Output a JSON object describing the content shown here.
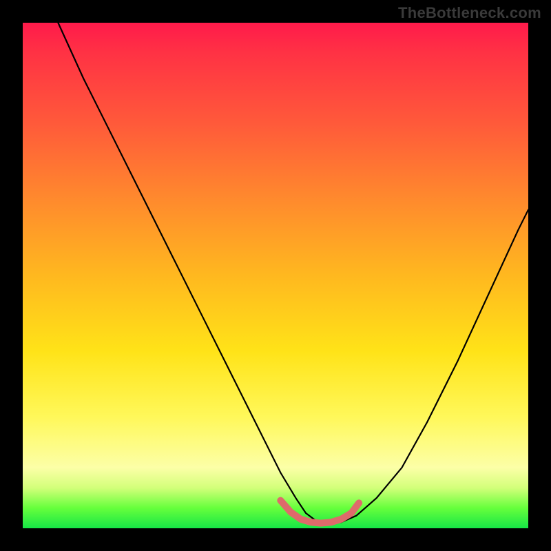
{
  "watermark": "TheBottleneck.com",
  "chart_data": {
    "type": "line",
    "title": "",
    "xlabel": "",
    "ylabel": "",
    "xlim": [
      0,
      100
    ],
    "ylim": [
      0,
      100
    ],
    "grid": false,
    "legend": false,
    "series": [
      {
        "name": "black-curve",
        "color": "#000000",
        "x": [
          7,
          12,
          18,
          24,
          30,
          36,
          42,
          47,
          51,
          54,
          56,
          58,
          60,
          63,
          66,
          70,
          75,
          80,
          86,
          92,
          98,
          100
        ],
        "y": [
          100,
          89,
          77,
          65,
          53,
          41,
          29,
          19,
          11,
          6,
          3,
          1.5,
          1,
          1.2,
          2.5,
          6,
          12,
          21,
          33,
          46,
          59,
          63
        ]
      },
      {
        "name": "pink-highlight",
        "color": "#de6b6b",
        "x": [
          51,
          53,
          55,
          57,
          59,
          61,
          63,
          65,
          66.5
        ],
        "y": [
          5.5,
          3.2,
          1.8,
          1.2,
          1.0,
          1.2,
          1.8,
          3.0,
          5.0
        ]
      }
    ],
    "background_gradient_stops": [
      {
        "pos": 0,
        "color": "#ff1a4b"
      },
      {
        "pos": 20,
        "color": "#ff5a3a"
      },
      {
        "pos": 50,
        "color": "#ffb81f"
      },
      {
        "pos": 78,
        "color": "#fff85a"
      },
      {
        "pos": 96,
        "color": "#66ff3c"
      },
      {
        "pos": 100,
        "color": "#16e646"
      }
    ]
  }
}
